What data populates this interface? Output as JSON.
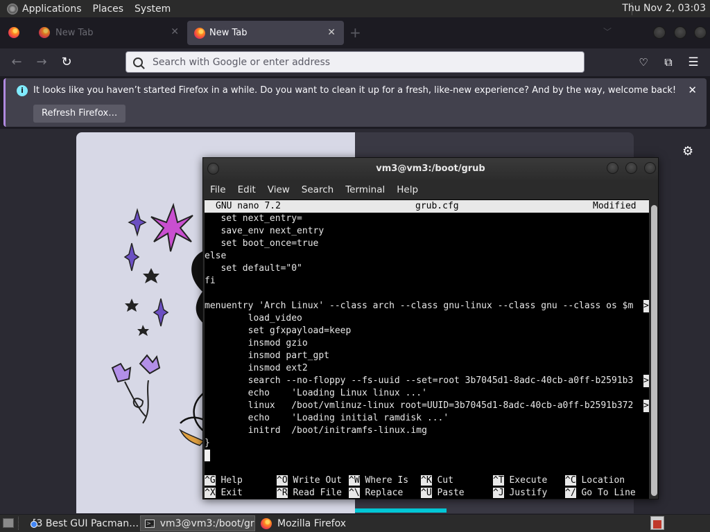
{
  "top_panel": {
    "menus": [
      "Applications",
      "Places",
      "System"
    ],
    "clock": "Thu Nov 2, 03:03"
  },
  "tabs": [
    {
      "title": "New Tab",
      "state": "background"
    },
    {
      "title": "New Tab",
      "state": "active"
    }
  ],
  "toolbar": {
    "url_placeholder": "Search with Google or enter address"
  },
  "notification": {
    "message": "It looks like you haven’t started Firefox in a while. Do you want to clean it up for a fresh, like-new experience? And by the way, welcome back!",
    "button": "Refresh Firefox…"
  },
  "terminal": {
    "title": "vm3@vm3:/boot/grub",
    "menu": [
      "File",
      "Edit",
      "View",
      "Search",
      "Terminal",
      "Help"
    ],
    "nano": {
      "version": "GNU nano 7.2",
      "filename": "grub.cfg",
      "status": "Modified"
    },
    "lines": [
      "   set next_entry=",
      "   save_env next_entry",
      "   set boot_once=true",
      "else",
      "   set default=\"0\"",
      "fi",
      "",
      "menuentry 'Arch Linux' --class arch --class gnu-linux --class gnu --class os $m",
      "        load_video",
      "        set gfxpayload=keep",
      "        insmod gzio",
      "        insmod part_gpt",
      "        insmod ext2",
      "        search --no-floppy --fs-uuid --set=root 3b7045d1-8adc-40cb-a0ff-b2591b3",
      "        echo    'Loading Linux linux ...'",
      "        linux   /boot/vmlinuz-linux root=UUID=3b7045d1-8adc-40cb-a0ff-b2591b372",
      "        echo    'Loading initial ramdisk ...'",
      "        initrd  /boot/initramfs-linux.img",
      "}"
    ],
    "truncation_marker": ">",
    "shortcuts_row1": [
      {
        "key": "^G",
        "label": "Help"
      },
      {
        "key": "^O",
        "label": "Write Out"
      },
      {
        "key": "^W",
        "label": "Where Is"
      },
      {
        "key": "^K",
        "label": "Cut"
      },
      {
        "key": "^T",
        "label": "Execute"
      },
      {
        "key": "^C",
        "label": "Location"
      }
    ],
    "shortcuts_row2": [
      {
        "key": "^X",
        "label": "Exit"
      },
      {
        "key": "^R",
        "label": "Read File"
      },
      {
        "key": "^\\",
        "label": "Replace"
      },
      {
        "key": "^U",
        "label": "Paste"
      },
      {
        "key": "^J",
        "label": "Justify"
      },
      {
        "key": "^/",
        "label": "Go To Line"
      }
    ]
  },
  "taskbar": {
    "tasks": [
      {
        "label": "[3 Best GUI Pacman…",
        "icon": "chrome-icon"
      },
      {
        "label": "vm3@vm3:/boot/gr…",
        "icon": "terminal-icon"
      },
      {
        "label": "Mozilla Firefox",
        "icon": "firefox-icon"
      }
    ]
  },
  "colors": {
    "accent_cyan": "#00c8d7",
    "info_icon": "#80ebff",
    "notification_border": "#b08ae0"
  }
}
